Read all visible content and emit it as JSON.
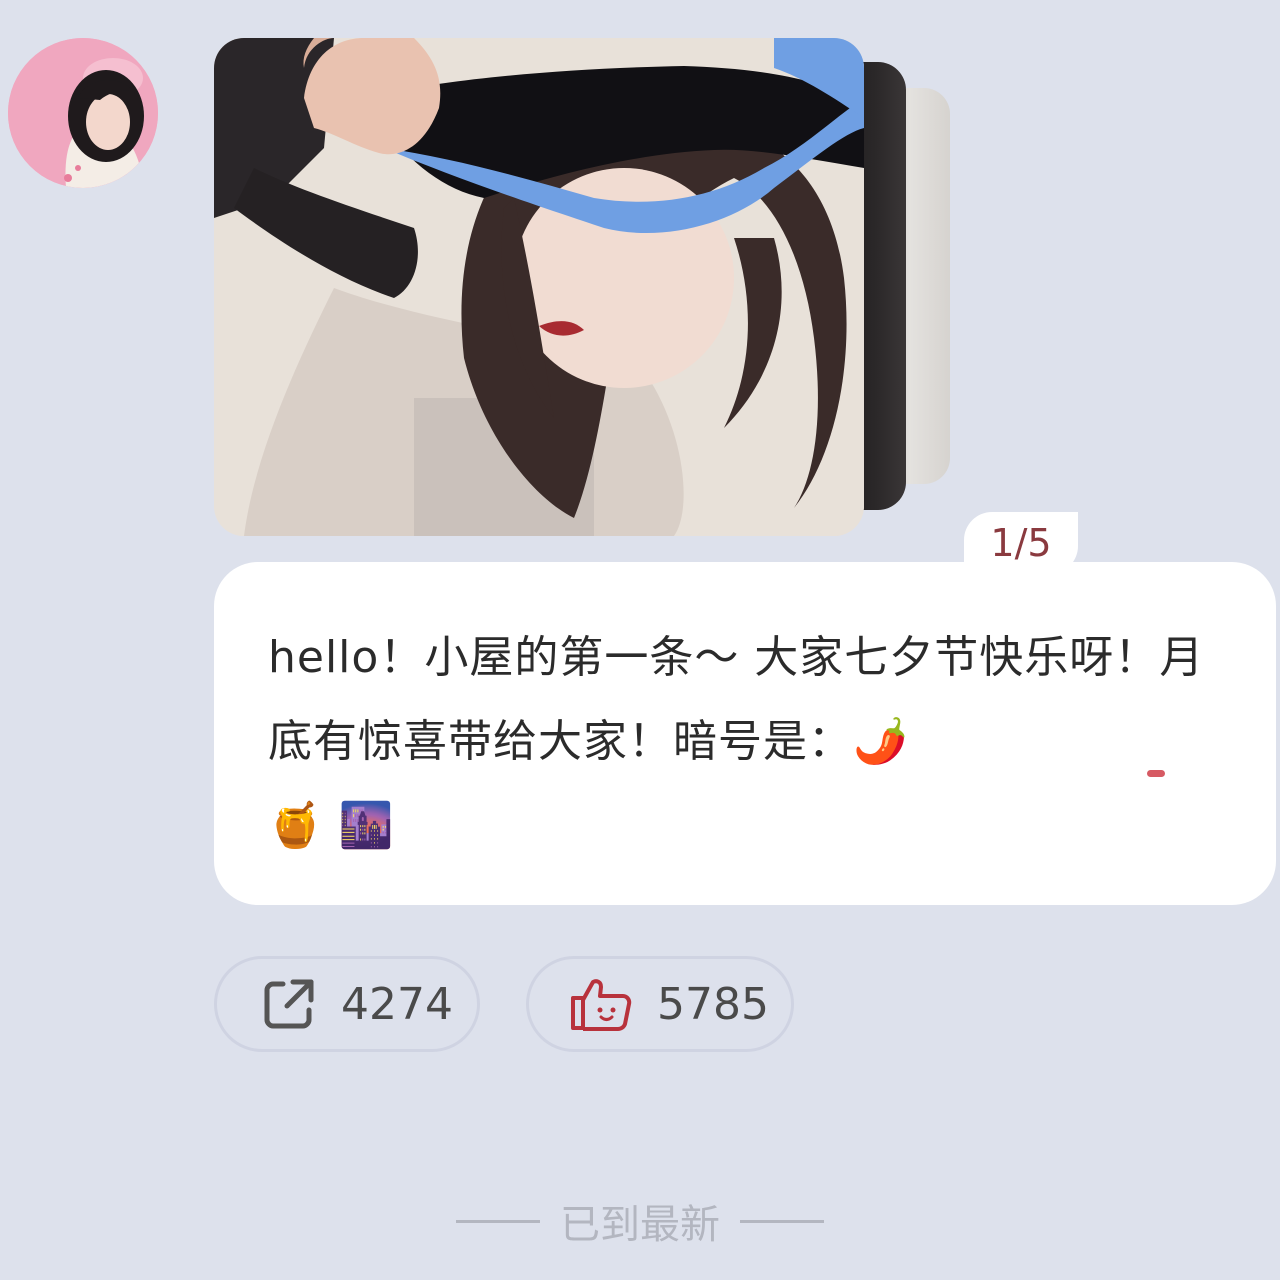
{
  "gallery": {
    "counter": "1/5",
    "current": 1,
    "total": 5
  },
  "post": {
    "text_before": "hello！小屋的第一条～ 大家七夕节快乐呀！",
    "highlighted": "月底有惊喜带",
    "text_after": "给大家！暗号是：",
    "emojis": [
      "🌶️",
      "🍯",
      "🌆"
    ]
  },
  "actions": {
    "share_count": "4274",
    "like_count": "5785"
  },
  "footer": {
    "end_text": "已到最新"
  },
  "colors": {
    "background": "#dde1ec",
    "card": "#ffffff",
    "accent_red": "#d65a63",
    "like_icon": "#b8323c",
    "counter_text": "#8a3a3f"
  },
  "icons": {
    "share": "share-arrow-icon",
    "like": "thumbs-up-icon"
  }
}
